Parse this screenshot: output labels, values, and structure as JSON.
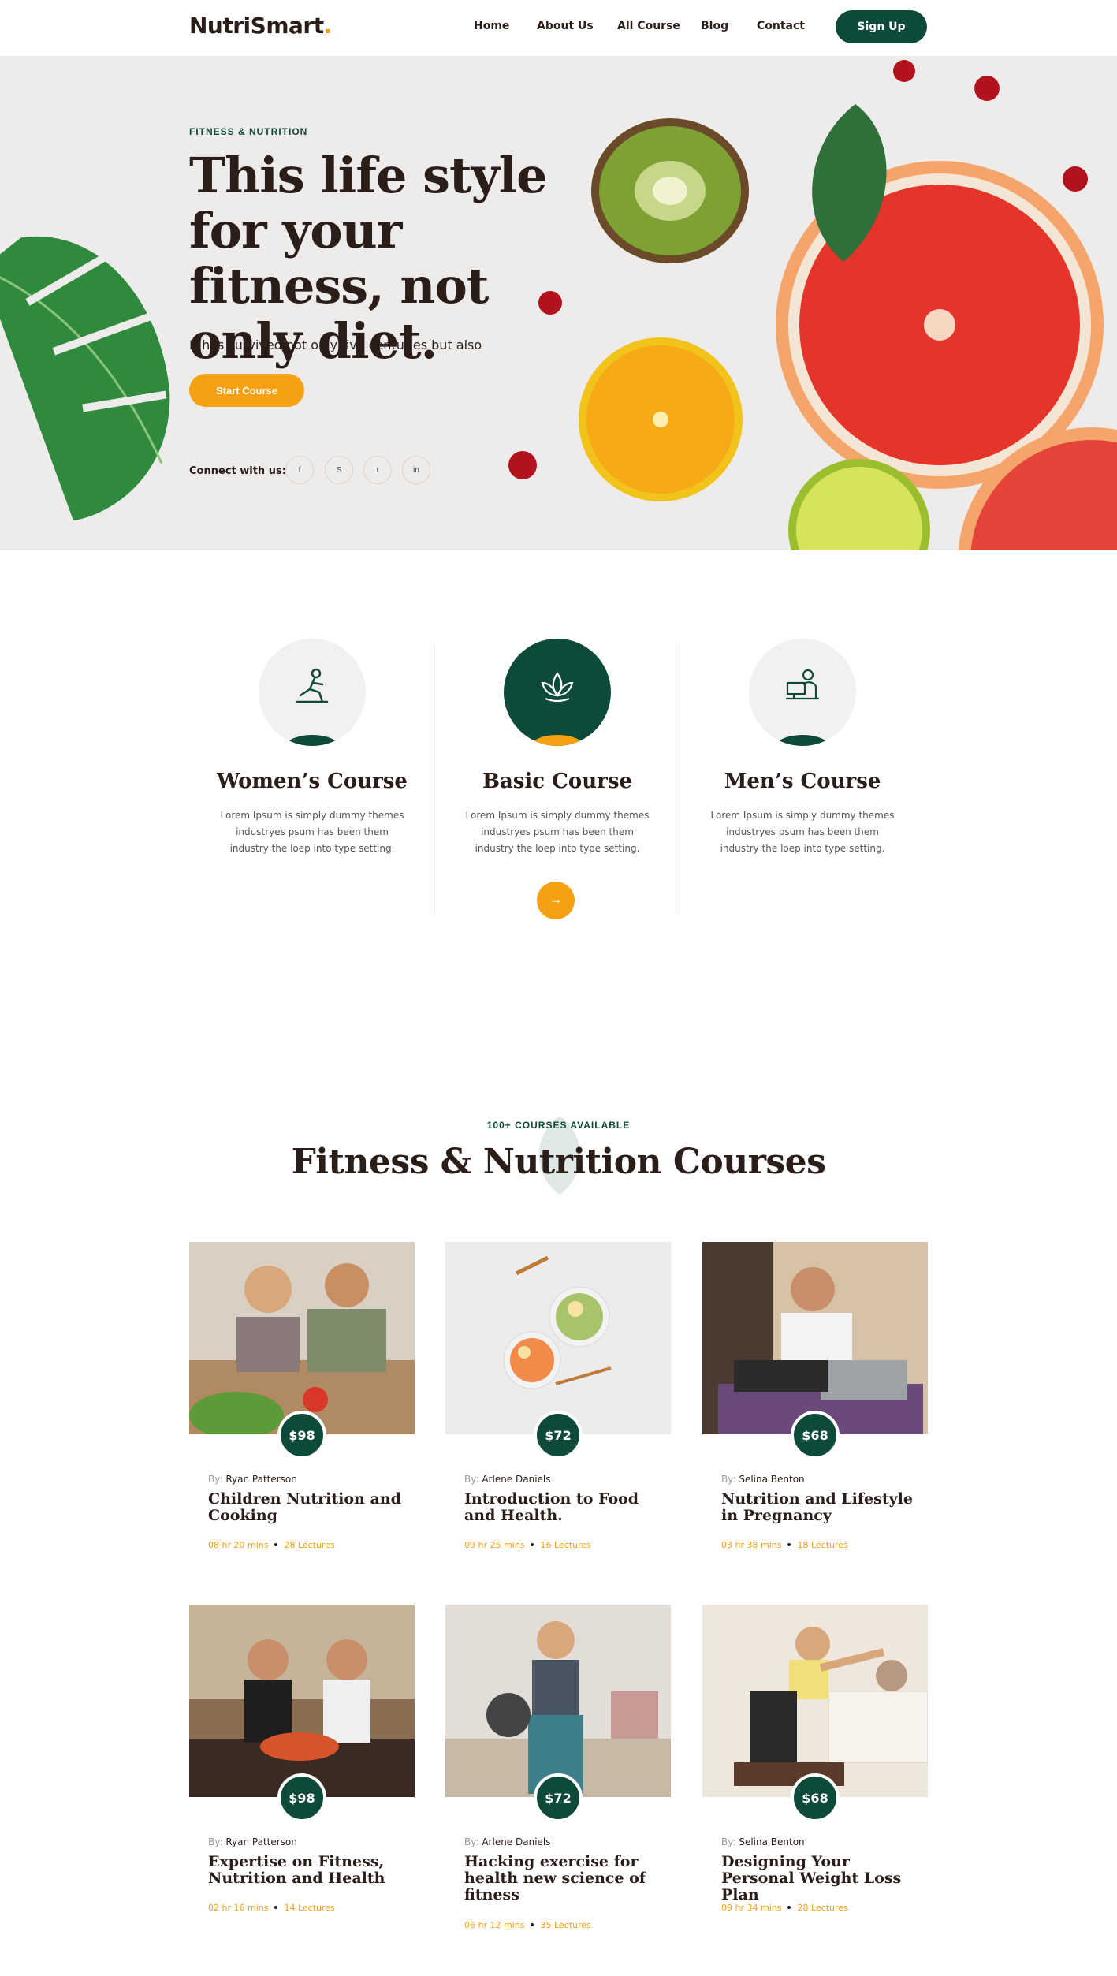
{
  "header": {
    "logo": "NutriSmart",
    "logo_dot": ".",
    "nav": [
      "Home",
      "About Us",
      "All Course",
      "Blog",
      "Contact"
    ],
    "signup_label": "Sign Up"
  },
  "hero": {
    "eyebrow": "FITNESS & NUTRITION",
    "title": "This life style for your fitness, not only diet.",
    "subtitle": "It has survived not only five centuries but also",
    "cta_label": "Start Course",
    "connect_label": "Connect with us:",
    "social_icons": [
      "facebook-icon",
      "skype-icon",
      "twitter-icon",
      "linkedin-icon"
    ],
    "social_glyphs": [
      "f",
      "S",
      "t",
      "in"
    ]
  },
  "categories": [
    {
      "title": "Women’s Course",
      "text": "Lorem Ipsum is simply dummy themes industryes psum has been them industry the loep into type setting.",
      "icon": "yoga-woman-icon"
    },
    {
      "title": "Basic Course",
      "text": "Lorem Ipsum is simply dummy themes industryes psum has been them industry the loep into type setting.",
      "icon": "lotus-icon",
      "arrow": "→"
    },
    {
      "title": "Men’s Course",
      "text": "Lorem Ipsum is simply dummy themes industryes psum has been them industry the loep into type setting.",
      "icon": "man-laptop-icon"
    }
  ],
  "courses_section": {
    "eyebrow": "100+ COURSES AVAILABLE",
    "title": "Fitness & Nutrition Courses"
  },
  "courses": [
    {
      "price": "$98",
      "by": "By:",
      "author": "Ryan Patterson",
      "title": "Children Nutrition and Cooking",
      "duration": "08 hr 20 mins",
      "lectures": "28 Lectures"
    },
    {
      "price": "$72",
      "by": "By:",
      "author": "Arlene Daniels",
      "title": "Introduction to Food and Health.",
      "duration": "09 hr 25 mins",
      "lectures": "16 Lectures"
    },
    {
      "price": "$68",
      "by": "By:",
      "author": "Selina Benton",
      "title": "Nutrition and Lifestyle in Pregnancy",
      "duration": "03 hr 38 mins",
      "lectures": "18 Lectures"
    },
    {
      "price": "$98",
      "by": "By:",
      "author": "Ryan Patterson",
      "title": "Expertise on Fitness, Nutrition and Health",
      "duration": "02 hr 16 mins",
      "lectures": "14 Lectures"
    },
    {
      "price": "$72",
      "by": "By:",
      "author": "Arlene Daniels",
      "title": "Hacking exercise for health new science of fitness",
      "duration": "06 hr 12 mins",
      "lectures": "35 Lectures"
    },
    {
      "price": "$68",
      "by": "By:",
      "author": "Selina Benton",
      "title": "Designing Your Personal Weight Loss Plan",
      "duration": "09 hr 34 mins",
      "lectures": "28 Lectures"
    }
  ],
  "colors": {
    "brand_green": "#0e4a3a",
    "accent_orange": "#f6a013",
    "text_dark": "#2b1d18",
    "hero_bg": "#eeeceb"
  }
}
